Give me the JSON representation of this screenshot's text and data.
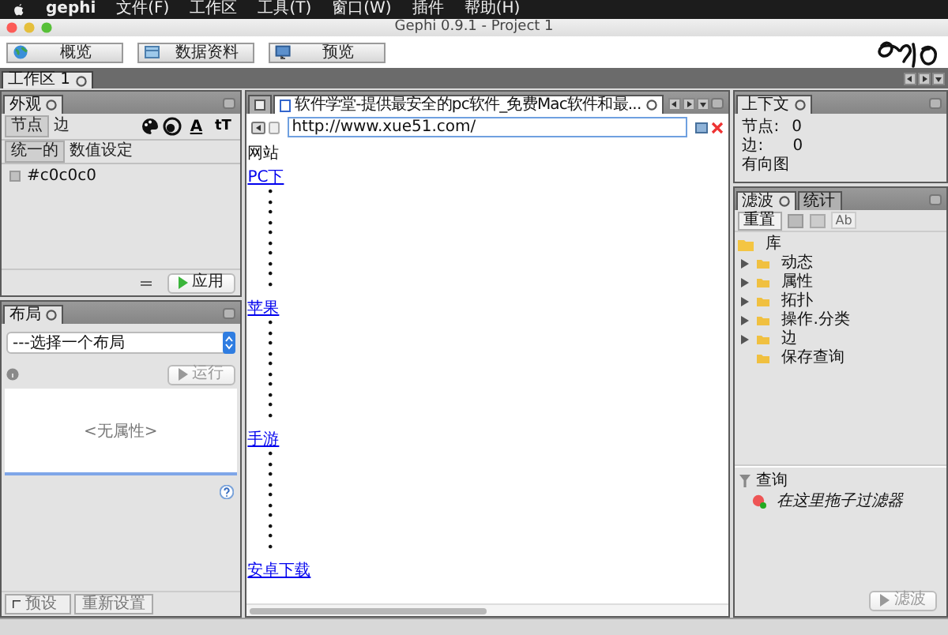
{
  "menu_bar": {
    "app_name": "gephi",
    "items": [
      "文件(F)",
      "工作区",
      "工具(T)",
      "窗口(W)",
      "插件",
      "帮助(H)"
    ]
  },
  "window": {
    "title": "Gephi 0.9.1 - Project 1"
  },
  "toolbar": {
    "buttons": [
      {
        "label": "概览",
        "kind": "overview"
      },
      {
        "label": "数据资料",
        "kind": "data"
      },
      {
        "label": "预览",
        "kind": "preview"
      }
    ]
  },
  "workspace_tabs": [
    {
      "label": "工作区 1",
      "selected": true
    }
  ],
  "appearance_panel": {
    "title": "外观",
    "element_tabs": [
      {
        "label": "节点",
        "selected": true
      },
      {
        "label": "边",
        "selected": false
      }
    ],
    "label_color_icon": "A",
    "label_size_icon": "tT",
    "mode_tabs": [
      {
        "label": "统一的",
        "selected": true
      },
      {
        "label": "数值设定",
        "selected": false
      }
    ],
    "color_value": "#c0c0c0",
    "apply_button": "应用"
  },
  "layout_panel": {
    "title": "布局",
    "select": {
      "value": "---选择一个布局"
    },
    "run_button": "运行",
    "empty_text": "<无属性>",
    "preset_button": "预设",
    "reset_button": "重新设置"
  },
  "browser": {
    "tab_title": "软件学堂-提供最安全的pc软件_免费Mac软件和最...",
    "url": "http://www.xue51.com/",
    "heading": "网站",
    "sections": [
      {
        "link": "PC下",
        "items": [
          "•",
          "•",
          "•",
          "•",
          "•",
          "•",
          "•",
          "•",
          "•",
          "•"
        ]
      },
      {
        "link": "苹果",
        "items": [
          "•",
          "•",
          "•",
          "•",
          "•",
          "•",
          "•",
          "•",
          "•",
          "•"
        ]
      },
      {
        "link": "手游",
        "items": [
          "•",
          "•",
          "•",
          "•",
          "•",
          "•",
          "•",
          "•",
          "•",
          "•"
        ]
      },
      {
        "link": "安卓下载"
      }
    ]
  },
  "context_panel": {
    "title": "上下文",
    "nodes_label": "节点:",
    "nodes_value": "0",
    "edges_label": "边:",
    "edges_value": "0",
    "graph_type": "有向图"
  },
  "filter_panel": {
    "tabs": [
      {
        "label": "滤波",
        "selected": true
      },
      {
        "label": "统计",
        "selected": false
      }
    ],
    "reset_button": "重置",
    "ab_button": "Ab",
    "tree": [
      {
        "label": "库",
        "kind": "root",
        "children": [
          {
            "label": "动态",
            "kind": "group"
          },
          {
            "label": "属性",
            "kind": "group"
          },
          {
            "label": "拓扑",
            "kind": "group"
          },
          {
            "label": "操作.分类",
            "kind": "group"
          },
          {
            "label": "边",
            "kind": "group"
          },
          {
            "label": "保存查询",
            "kind": "leaf"
          }
        ]
      }
    ],
    "query_title": "查询",
    "query_hint": "在这里拖子过滤器",
    "filter_button": "滤波"
  }
}
